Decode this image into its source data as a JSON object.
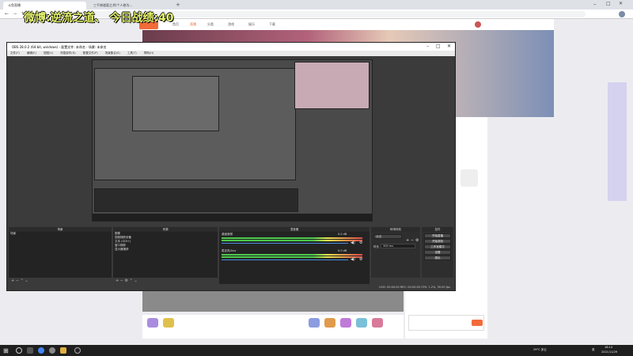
{
  "browser": {
    "tabs": [
      {
        "label": "斗鱼直播"
      },
      {
        "label": "三千修道君之术(个人修为..."
      }
    ],
    "new_tab": "+"
  },
  "overlay": {
    "title": "微博:逆流之道、 今日战绩:40"
  },
  "site": {
    "nav": [
      "首页",
      "直播",
      "分类",
      "游戏",
      "娱乐",
      "下载",
      "发布"
    ]
  },
  "obs": {
    "window_title": "OBS 28.0.2 (64-bit, windows) - 配置文件: 未命名 - 场景: 未命名",
    "menu": [
      "文件(F)",
      "编辑(E)",
      "视图(V)",
      "停靠部件(D)",
      "配置文件(P)",
      "场景集合(S)",
      "工具(T)",
      "帮助(H)"
    ],
    "docks": {
      "scenes": {
        "title": "场景",
        "items": [
          "场景"
        ]
      },
      "sources": {
        "title": "来源",
        "items": [
          "图像",
          "视频捕获设备",
          "文本 (GDI+)",
          "窗口捕获",
          "显示器捕获"
        ]
      },
      "mixer": {
        "title": "混音器",
        "channels": [
          {
            "name": "桌面音频",
            "level": "0.0 dB"
          },
          {
            "name": "麦克风/Aux",
            "level": "0.0 dB"
          }
        ]
      },
      "transitions": {
        "title": "转场特效",
        "type": "淡出",
        "duration_label": "时长",
        "duration": "300 ms"
      },
      "controls": {
        "title": "控件",
        "buttons": [
          "开始直播",
          "开始录制",
          "工作室模式",
          "设置",
          "退出"
        ]
      }
    },
    "status": "LIVE: 00:00:00   REC: 00:00:00   CPU: 1.2%, 30.00 fps"
  },
  "taskbar": {
    "tray_text": "29°C 多云",
    "lang": "英",
    "time": "18:14",
    "date": "2021/11/29"
  }
}
